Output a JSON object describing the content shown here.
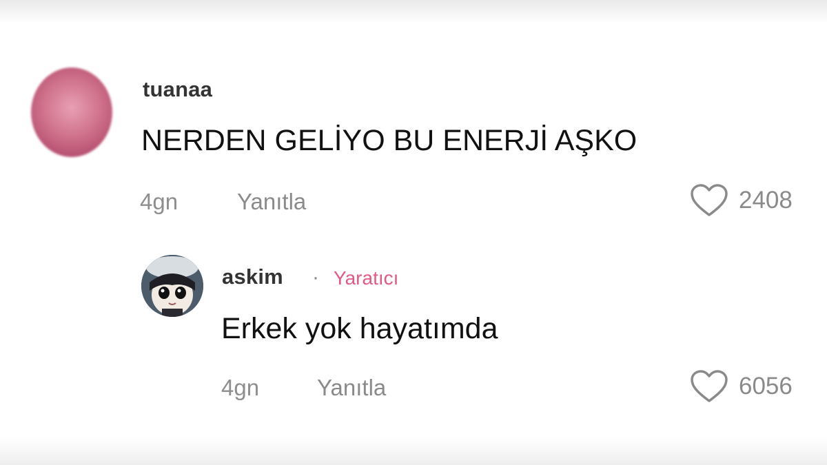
{
  "comments": [
    {
      "username": "tuanaa",
      "text": "NERDEN GELİYO BU ENERJİ AŞKO",
      "age": "4gn",
      "reply_label": "Yanıtla",
      "likes": "2408",
      "avatar_icon": "pink-blurred-avatar"
    }
  ],
  "reply": {
    "username": "askim",
    "separator": "·",
    "badge": "Yaratıcı",
    "text": "Erkek yok hayatımda",
    "age": "4gn",
    "reply_label": "Yanıtla",
    "likes": "6056",
    "avatar_icon": "cartoon-girl-avatar"
  },
  "colors": {
    "creator_badge": "#e05a84",
    "meta_gray": "#8e8e8e"
  },
  "icons": {
    "like": "heart-outline-icon"
  }
}
